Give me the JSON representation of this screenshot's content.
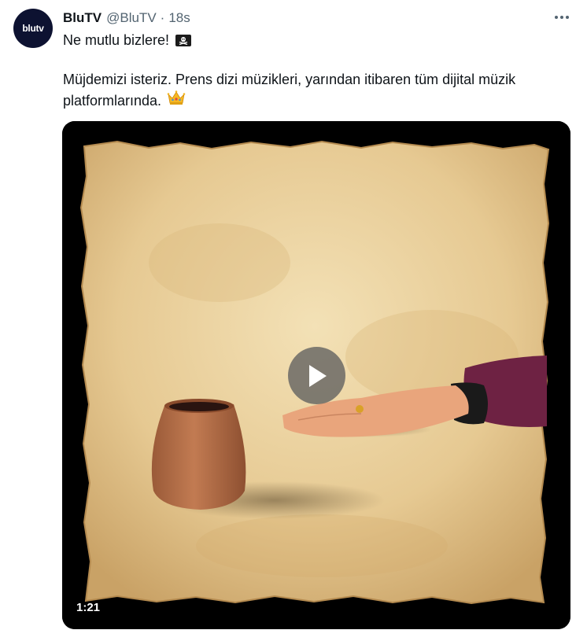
{
  "author": {
    "avatar_text": "blutv",
    "display_name": "BluTV",
    "handle": "@BluTV",
    "separator": "·",
    "time": "18s"
  },
  "tweet": {
    "line1": "Ne mutlu bizlere!",
    "line2": "Müjdemizi isteriz. Prens dizi müzikleri, yarından itibaren tüm dijital müzik",
    "line3": "platformlarında."
  },
  "icons": {
    "more": "more-icon",
    "pirate_flag": "pirate-flag-icon",
    "crown": "crown-icon",
    "play": "play-icon"
  },
  "media": {
    "type": "video",
    "duration": "1:21",
    "colors": {
      "background": "#000000",
      "parchment": "#e6c992",
      "cup": "#b26d47",
      "sleeve": "#6e2243"
    }
  }
}
